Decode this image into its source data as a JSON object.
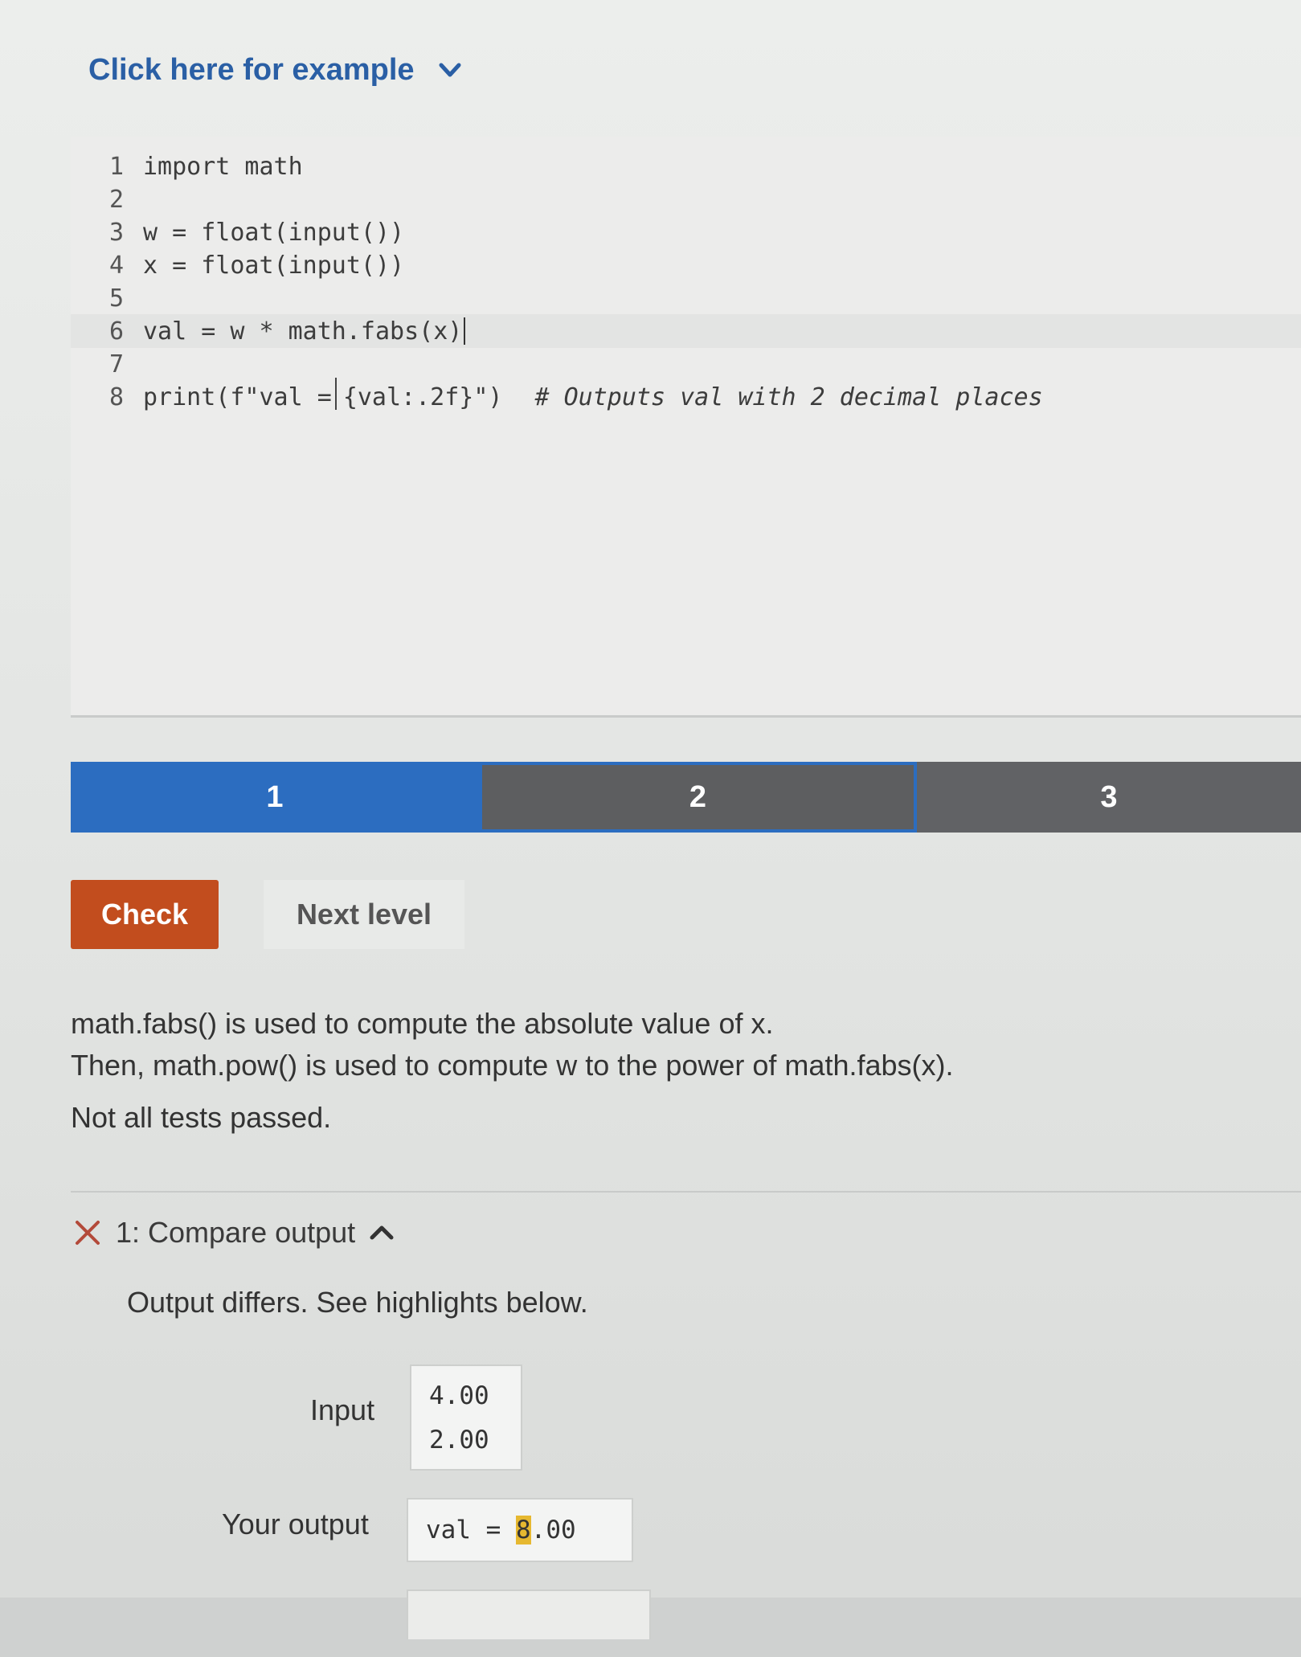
{
  "example": {
    "label": "Click here for example"
  },
  "code": {
    "lines": [
      {
        "num": "1",
        "text": "import math"
      },
      {
        "num": "2",
        "text": ""
      },
      {
        "num": "3",
        "text": "w = float(input())"
      },
      {
        "num": "4",
        "text": "x = float(input())"
      },
      {
        "num": "5",
        "text": ""
      },
      {
        "num": "6",
        "text": "val = w * math.fabs(x)"
      },
      {
        "num": "7",
        "text": ""
      },
      {
        "num": "8",
        "pre": "print(f\"val =",
        "post": "{val:.2f}\")",
        "comment": "# Outputs val with 2 decimal places"
      }
    ]
  },
  "levels": [
    "1",
    "2",
    "3"
  ],
  "buttons": {
    "check": "Check",
    "next": "Next level"
  },
  "explanation": [
    "math.fabs() is used to compute the absolute value of x.",
    "Then, math.pow() is used to compute w to the power of math.fabs(x)."
  ],
  "status": "Not all tests passed.",
  "test": {
    "header": "1: Compare output",
    "message": "Output differs. See highlights below.",
    "input_label": "Input",
    "input_lines": [
      "4.00",
      "2.00"
    ],
    "output_label": "Your output",
    "output_pre": "val = ",
    "output_highlight": "8",
    "output_post": ".00"
  },
  "colors": {
    "accent": "#2c6dc0",
    "check_button": "#c24d1e",
    "diff_highlight": "#e6b830"
  }
}
